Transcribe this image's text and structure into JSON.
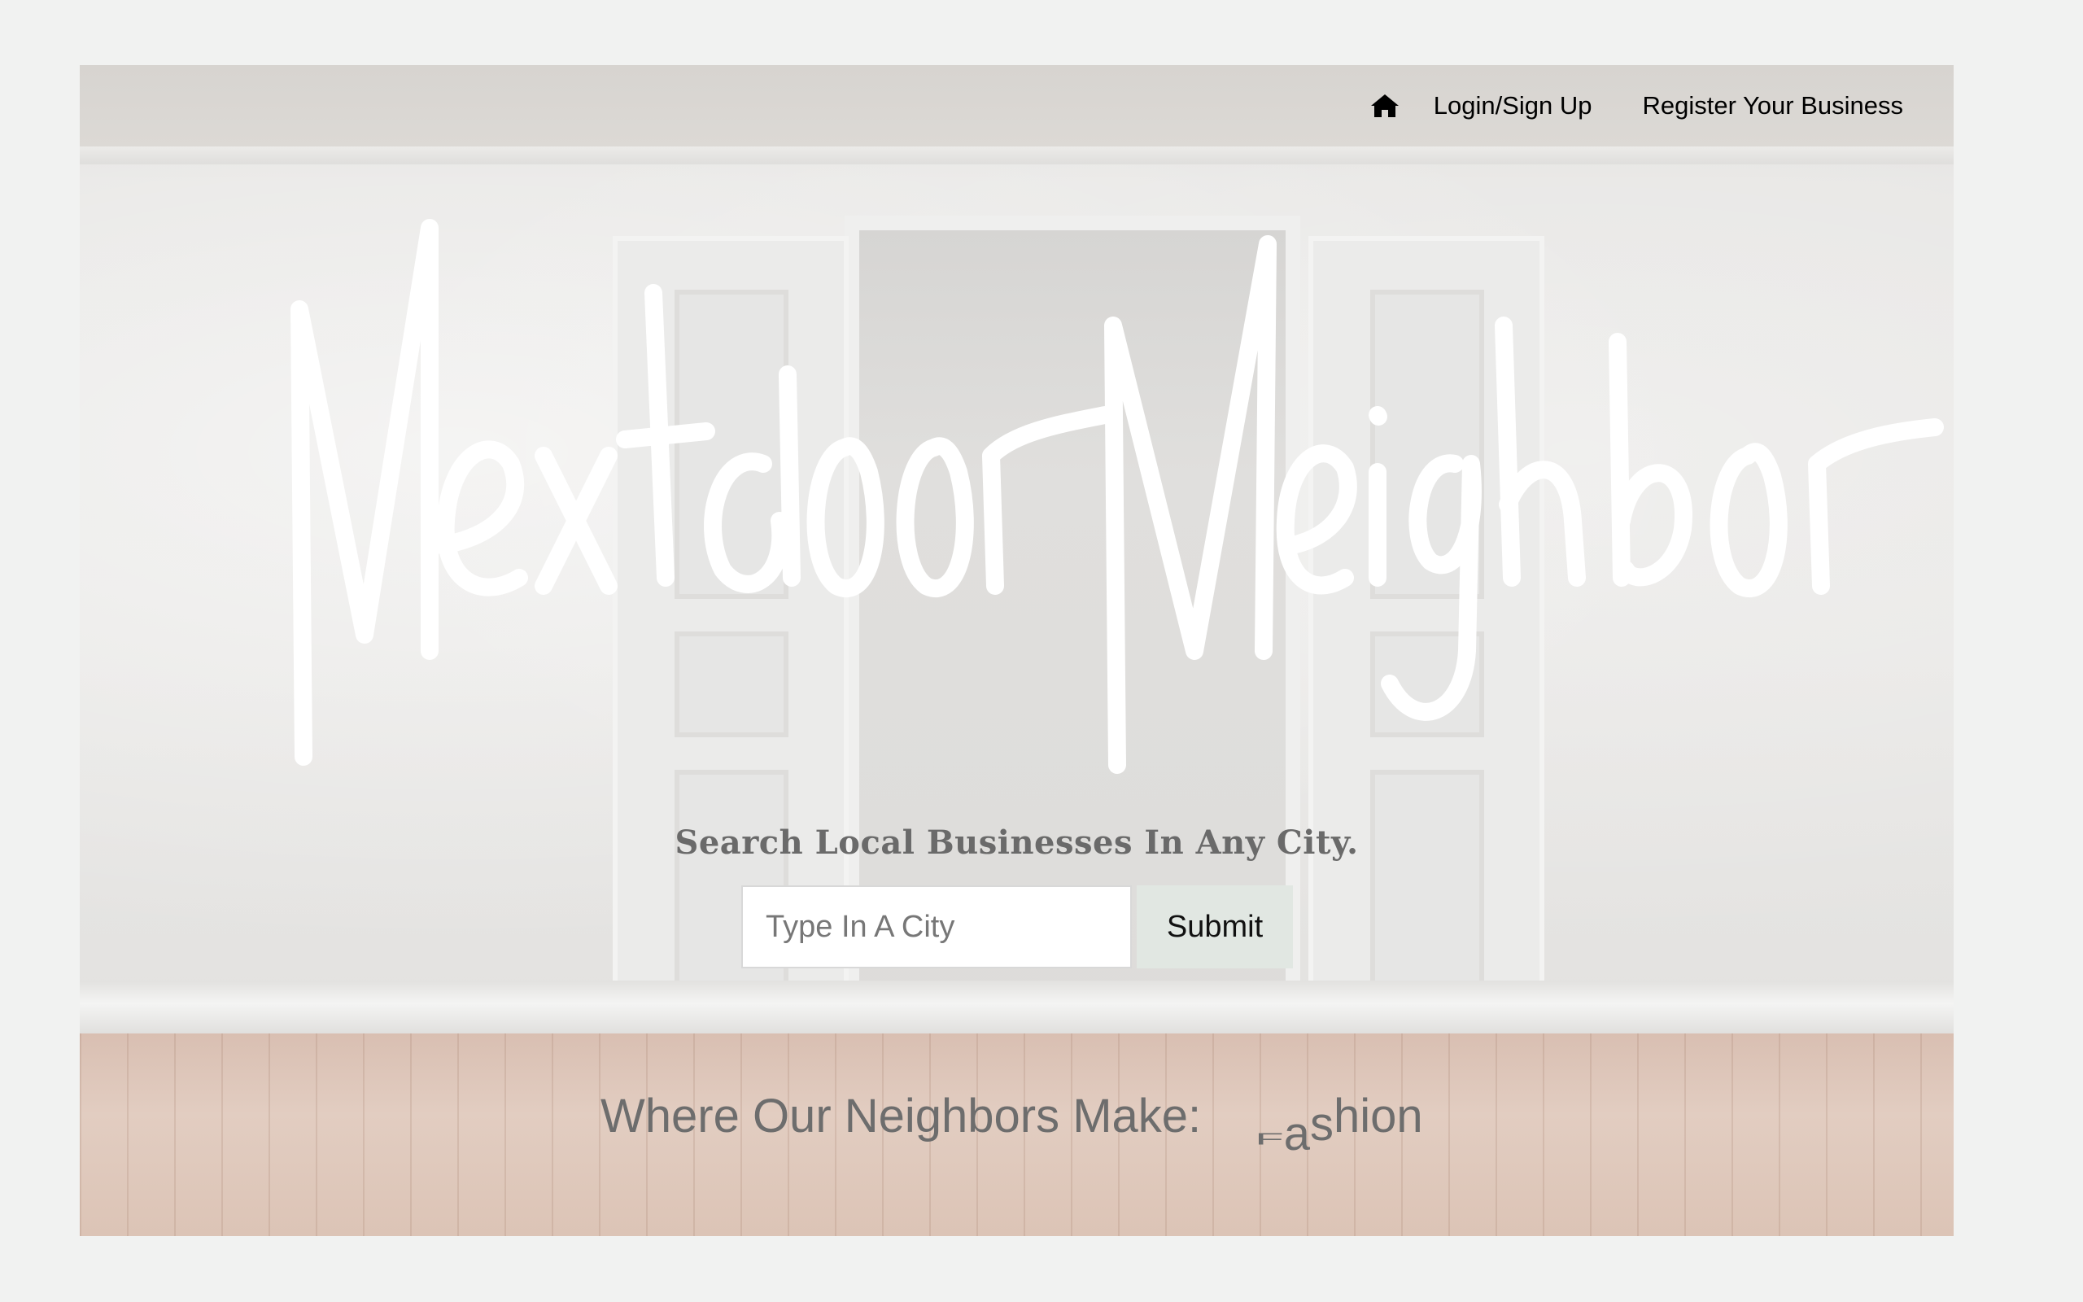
{
  "nav": {
    "home_icon": "home-icon",
    "links": [
      "Login/Sign Up",
      "Register Your Business"
    ]
  },
  "brand": {
    "title": "Nextdoor Neighbor"
  },
  "search": {
    "heading": "Search Local Businesses In Any City.",
    "placeholder": "Type In A City",
    "submit_label": "Submit"
  },
  "tagline": {
    "prefix": "Where Our Neighbors Make:",
    "rotating_word": "Fashion"
  },
  "colors": {
    "page_bg": "#f1f2f1",
    "brand_text": "#ffffff",
    "heading_text": "#6a6a6a",
    "submit_bg": "#e1e7e2"
  }
}
